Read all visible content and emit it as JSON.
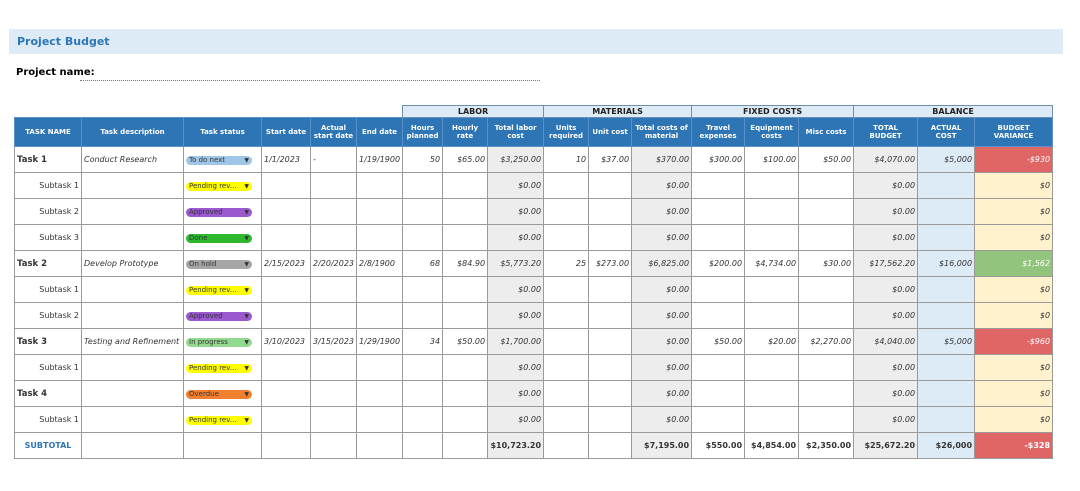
{
  "title": "Project Budget",
  "project_name_label": "Project name:",
  "groups": {
    "labor": "LABOR",
    "materials": "MATERIALS",
    "fixed": "FIXED COSTS",
    "balance": "BALANCE"
  },
  "headers": [
    "TASK NAME",
    "Task description",
    "Task status",
    "Start date",
    "Actual start date",
    "End date",
    "Hours planned",
    "Hourly rate",
    "Total labor cost",
    "Units required",
    "Unit cost",
    "Total costs of material",
    "Travel expenses",
    "Equipment costs",
    "Misc costs",
    "TOTAL BUDGET",
    "ACTUAL COST",
    "BUDGET VARIANCE"
  ],
  "status_colors": {
    "To do next": "#9fc5e8",
    "Pending rev...": "#ffff00",
    "Approved": "#9b59d0",
    "Done": "#2eb82e",
    "On hold": "#a6a6a6",
    "In progress": "#93d98f",
    "Overdue": "#f08030"
  },
  "rows": [
    {
      "name": "Task 1",
      "desc": "Conduct Research",
      "status": "To do next",
      "start": "1/1/2023",
      "actual": "-",
      "end": "1/19/1900",
      "hours": "50",
      "rate": "$65.00",
      "labor": "$3,250.00",
      "units": "10",
      "unit_cost": "$37.00",
      "material": "$370.00",
      "travel": "$300.00",
      "equip": "$100.00",
      "misc": "$50.00",
      "budget": "$4,070.00",
      "actual_cost": "$5,000",
      "variance": "-$930",
      "var_color": "red"
    },
    {
      "name": "Subtask 1",
      "status": "Pending rev...",
      "labor": "$0.00",
      "material": "$0.00",
      "budget": "$0.00",
      "variance": "$0"
    },
    {
      "name": "Subtask 2",
      "status": "Approved",
      "labor": "$0.00",
      "material": "$0.00",
      "budget": "$0.00",
      "variance": "$0"
    },
    {
      "name": "Subtask 3",
      "status": "Done",
      "labor": "$0.00",
      "material": "$0.00",
      "budget": "$0.00",
      "variance": "$0"
    },
    {
      "name": "Task 2",
      "desc": "Develop Prototype",
      "status": "On hold",
      "start": "2/15/2023",
      "actual": "2/20/2023",
      "end": "2/8/1900",
      "hours": "68",
      "rate": "$84.90",
      "labor": "$5,773.20",
      "units": "25",
      "unit_cost": "$273.00",
      "material": "$6,825.00",
      "travel": "$200.00",
      "equip": "$4,734.00",
      "misc": "$30.00",
      "budget": "$17,562.20",
      "actual_cost": "$16,000",
      "variance": "$1,562",
      "var_color": "green"
    },
    {
      "name": "Subtask 1",
      "status": "Pending rev...",
      "labor": "$0.00",
      "material": "$0.00",
      "budget": "$0.00",
      "variance": "$0"
    },
    {
      "name": "Subtask 2",
      "status": "Approved",
      "labor": "$0.00",
      "material": "$0.00",
      "budget": "$0.00",
      "variance": "$0"
    },
    {
      "name": "Task 3",
      "desc": "Testing and Refinement",
      "status": "In progress",
      "start": "3/10/2023",
      "actual": "3/15/2023",
      "end": "1/29/1900",
      "hours": "34",
      "rate": "$50.00",
      "labor": "$1,700.00",
      "material": "$0.00",
      "travel": "$50.00",
      "equip": "$20.00",
      "misc": "$2,270.00",
      "budget": "$4,040.00",
      "actual_cost": "$5,000",
      "variance": "-$960",
      "var_color": "red"
    },
    {
      "name": "Subtask 1",
      "status": "Pending rev...",
      "labor": "$0.00",
      "material": "$0.00",
      "budget": "$0.00",
      "variance": "$0"
    },
    {
      "name": "Task 4",
      "status": "Overdue",
      "labor": "$0.00",
      "material": "$0.00",
      "budget": "$0.00",
      "variance": "$0"
    },
    {
      "name": "Subtask 1",
      "status": "Pending rev...",
      "labor": "$0.00",
      "material": "$0.00",
      "budget": "$0.00",
      "variance": "$0"
    }
  ],
  "subtotal": {
    "label": "SUBTOTAL",
    "labor": "$10,723.20",
    "material": "$7,195.00",
    "travel": "$550.00",
    "equip": "$4,854.00",
    "misc": "$2,350.00",
    "budget": "$25,672.20",
    "actual_cost": "$26,000",
    "variance": "-$328"
  }
}
